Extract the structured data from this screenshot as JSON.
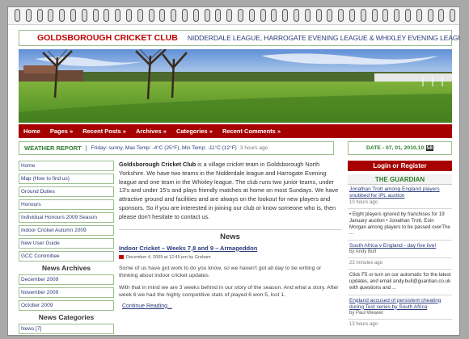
{
  "header": {
    "title": "GOLDSBOROUGH CRICKET CLUB",
    "tagline": "NIDDERDALE LEAGUE, HARROGATE EVENING LEAGUE & WHIXLEY EVENING LEAGUE"
  },
  "nav": [
    "Home",
    "Pages »",
    "Recent Posts »",
    "Archives »",
    "Categories »",
    "Recent Comments »"
  ],
  "weather": {
    "label": "WEATHER REPORT",
    "text": "Friday: sunny, Max Temp: -4°C (25°F), Min Temp: -11°C (12°F)",
    "ago": "3 hours ago"
  },
  "date": {
    "label": "DATE - 07, 01, 2010, ",
    "time": "10:",
    "seconds": "58"
  },
  "sidebar": {
    "pages": [
      "Home",
      "Map (How to find us)",
      "Ground Duties",
      "Honours",
      "Individual Honours 2009 Season",
      "Indoor Cricket Autumn 2009",
      "New User Guide",
      "GCC Committee"
    ],
    "archives_heading": "News Archives",
    "archives": [
      "December 2009",
      "November 2009",
      "October 2009"
    ],
    "categories_heading": "News Categories",
    "categories": [
      "News [7]"
    ]
  },
  "intro": {
    "club_name": "Goldsborough Cricket Club",
    "text": " is a village cricket team in Goldsborough North Yorkshire. We have two teams in the Nidderdale league and Harrogate Evening league and one team in the Whixley league. The club runs two junior teams, under 13's and under 15's and plays friendly matches at home on most Sundays. We have attractive ground and facilities and are always on the lookout for new players and sponsors. So if you are interested in joining our club or know someone who is, then please don't hesitate to contact us."
  },
  "news": {
    "heading": "News",
    "post_title": "Indoor Cricket – Weeks 7,8 and 9 – Armageddon",
    "post_meta": "December 4, 2009 at 12:45 pm by Graham",
    "paragraphs": [
      "Some of us have got work to do you know, so we haven't got all day to be writing or thinking about indoor cricket updates.",
      "With that in mind we are 3 weeks behind in our story of the season. And what a story. After week 6 we had the highly competitive stats of played 6 won 5, lost 1."
    ],
    "continue": "Continue Reading..."
  },
  "right": {
    "login": "Login or Register",
    "feed_heading": "THE GUARDIAN",
    "feed": [
      {
        "title": "Jonathan Trott among England players snubbed for IPL auction",
        "author": "",
        "time": "10 hours ago",
        "desc": "• Eight players ignored by franchises for 19 January auction • Jonathan Trott, Eoin Morgan among players to be passed overThe ..."
      },
      {
        "title": "South Africa v England - day five live!",
        "author": "by Andy Bull",
        "time": "23 minutes ago",
        "desc": "Click F5 or turn on our automatic for the latest updates, and email andy.bull@guardian.co.uk with questions and ..."
      },
      {
        "title": "England accused of persistent cheating during Test series by South Africa",
        "author": "by Paul Weaver",
        "time": "13 hours ago",
        "desc": ""
      }
    ]
  },
  "colors": {
    "accent": "#a60000",
    "title": "#c00000",
    "link": "#2a3a7a",
    "green": "#2d7d2d"
  }
}
